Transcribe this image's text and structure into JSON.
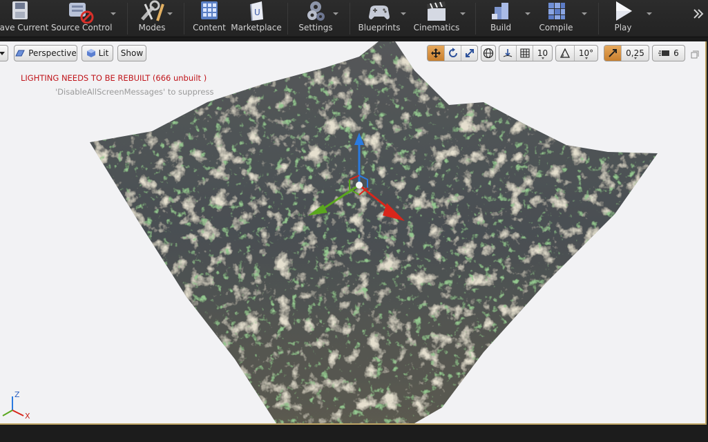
{
  "toolbar": {
    "save_current": "Save Current",
    "source_control": "Source Control",
    "modes": "Modes",
    "content": "Content",
    "marketplace": "Marketplace",
    "settings": "Settings",
    "blueprints": "Blueprints",
    "cinematics": "Cinematics",
    "build": "Build",
    "compile": "Compile",
    "play": "Play"
  },
  "viewport": {
    "view_mode": "Perspective",
    "lighting_mode": "Lit",
    "show": "Show",
    "grid_snap": "10",
    "rotation_snap": "10°",
    "scale_snap": "0,25",
    "camera_speed": "6",
    "warning": "LIGHTING NEEDS TO BE REBUILT (666 unbuilt )",
    "suppress_hint": "'DisableAllScreenMessages' to suppress",
    "axis_z": "Z",
    "axis_x": "X"
  },
  "colors": {
    "warning": "#c0141a",
    "active_orange": "#d8913f",
    "gizmo_x": "#d9261b",
    "gizmo_y": "#5aa71e",
    "gizmo_z": "#2b7be0"
  }
}
